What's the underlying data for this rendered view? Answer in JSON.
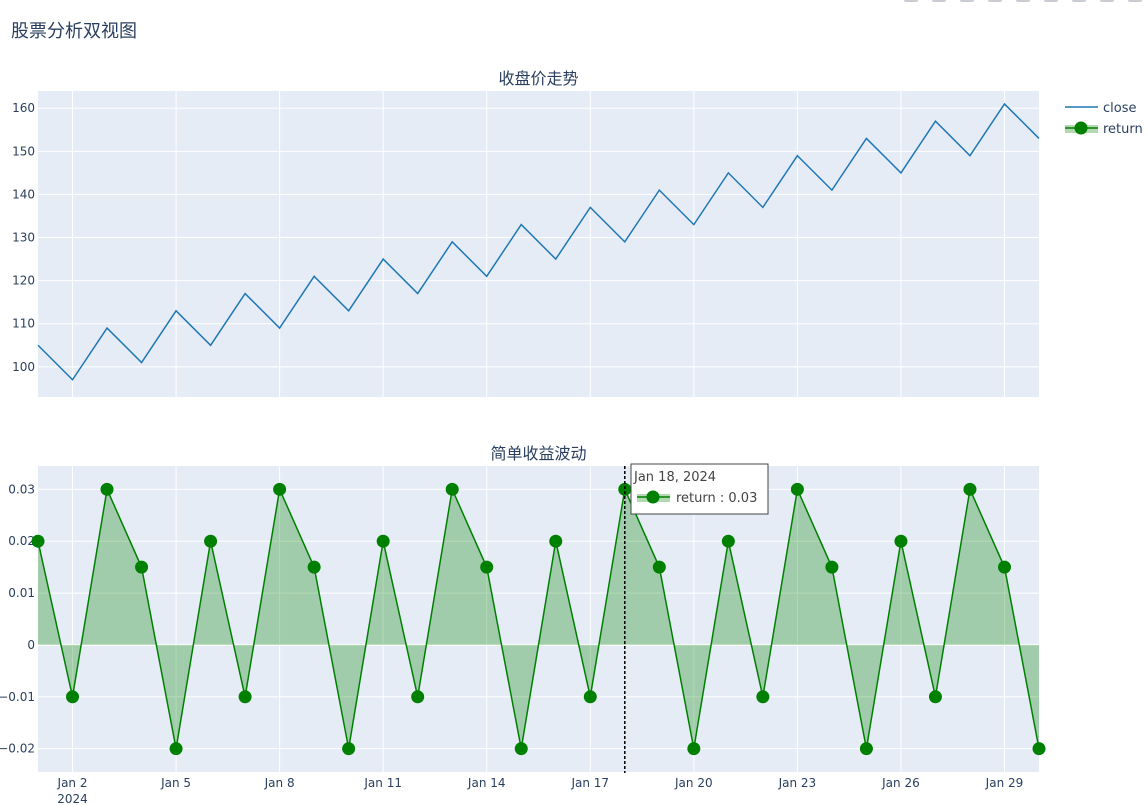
{
  "figure_title": "股票分析双视图",
  "colors": {
    "plot_bg": "#E5ECF6",
    "grid": "#ffffff",
    "close_line": "#1f77b4",
    "return_line": "green",
    "return_fill": "rgba(0,128,0,0.3)",
    "text": "#2a3f5f"
  },
  "legend": {
    "placement": "top-right",
    "items": [
      {
        "name": "close",
        "symbol": "line"
      },
      {
        "name": "return",
        "symbol": "line-marker-fill"
      }
    ]
  },
  "tooltip": {
    "date_label": "Jan 18, 2024",
    "text": "return : 0.03",
    "at_date": "2024-01-18"
  },
  "modebar_icons": [
    "camera-icon",
    "zoom-icon",
    "pan-icon",
    "select-icon",
    "lasso-icon",
    "zoom-in-icon",
    "zoom-out-icon",
    "autoscale-icon",
    "reset-icon"
  ],
  "chart_data": [
    {
      "type": "line",
      "title": "收盘价走势",
      "series": [
        {
          "name": "close",
          "x": [
            "2024-01-01",
            "2024-01-02",
            "2024-01-03",
            "2024-01-04",
            "2024-01-05",
            "2024-01-06",
            "2024-01-07",
            "2024-01-08",
            "2024-01-09",
            "2024-01-10",
            "2024-01-11",
            "2024-01-12",
            "2024-01-13",
            "2024-01-14",
            "2024-01-15",
            "2024-01-16",
            "2024-01-17",
            "2024-01-18",
            "2024-01-19",
            "2024-01-20",
            "2024-01-21",
            "2024-01-22",
            "2024-01-23",
            "2024-01-24",
            "2024-01-25",
            "2024-01-26",
            "2024-01-27",
            "2024-01-28",
            "2024-01-29",
            "2024-01-30"
          ],
          "values": [
            105,
            97,
            109,
            101,
            113,
            105,
            117,
            109,
            121,
            113,
            125,
            117,
            129,
            121,
            133,
            125,
            137,
            129,
            141,
            133,
            145,
            137,
            149,
            141,
            153,
            145,
            157,
            149,
            161,
            153
          ]
        }
      ],
      "xlim": [
        "2024-01-01",
        "2024-01-30"
      ],
      "ylim": [
        93,
        164
      ],
      "yticks": [
        100,
        110,
        120,
        130,
        140,
        150,
        160
      ],
      "grid": true
    },
    {
      "type": "area",
      "title": "简单收益波动",
      "series": [
        {
          "name": "return",
          "x": [
            "2024-01-01",
            "2024-01-02",
            "2024-01-03",
            "2024-01-04",
            "2024-01-05",
            "2024-01-06",
            "2024-01-07",
            "2024-01-08",
            "2024-01-09",
            "2024-01-10",
            "2024-01-11",
            "2024-01-12",
            "2024-01-13",
            "2024-01-14",
            "2024-01-15",
            "2024-01-16",
            "2024-01-17",
            "2024-01-18",
            "2024-01-19",
            "2024-01-20",
            "2024-01-21",
            "2024-01-22",
            "2024-01-23",
            "2024-01-24",
            "2024-01-25",
            "2024-01-26",
            "2024-01-27",
            "2024-01-28",
            "2024-01-29",
            "2024-01-30"
          ],
          "values": [
            0.02,
            -0.01,
            0.03,
            0.015,
            -0.02,
            0.02,
            -0.01,
            0.03,
            0.015,
            -0.02,
            0.02,
            -0.01,
            0.03,
            0.015,
            -0.02,
            0.02,
            -0.01,
            0.03,
            0.015,
            -0.02,
            0.02,
            -0.01,
            0.03,
            0.015,
            -0.02,
            0.02,
            -0.01,
            0.03,
            0.015,
            -0.02
          ]
        }
      ],
      "xlim": [
        "2024-01-01",
        "2024-01-30"
      ],
      "ylim": [
        -0.0245,
        0.0345
      ],
      "yticks": [
        -0.02,
        -0.01,
        0,
        0.01,
        0.02,
        0.03
      ],
      "ytick_labels": [
        "−0.02",
        "−0.01",
        "0",
        "0.01",
        "0.02",
        "0.03"
      ],
      "xticks": [
        "2024-01-02",
        "2024-01-05",
        "2024-01-08",
        "2024-01-11",
        "2024-01-14",
        "2024-01-17",
        "2024-01-20",
        "2024-01-23",
        "2024-01-26",
        "2024-01-29"
      ],
      "xtick_labels": [
        "Jan 2",
        "Jan 5",
        "Jan 8",
        "Jan 11",
        "Jan 14",
        "Jan 17",
        "Jan 20",
        "Jan 23",
        "Jan 26",
        "Jan 29"
      ],
      "xtick_year": "2024",
      "grid": true
    }
  ]
}
